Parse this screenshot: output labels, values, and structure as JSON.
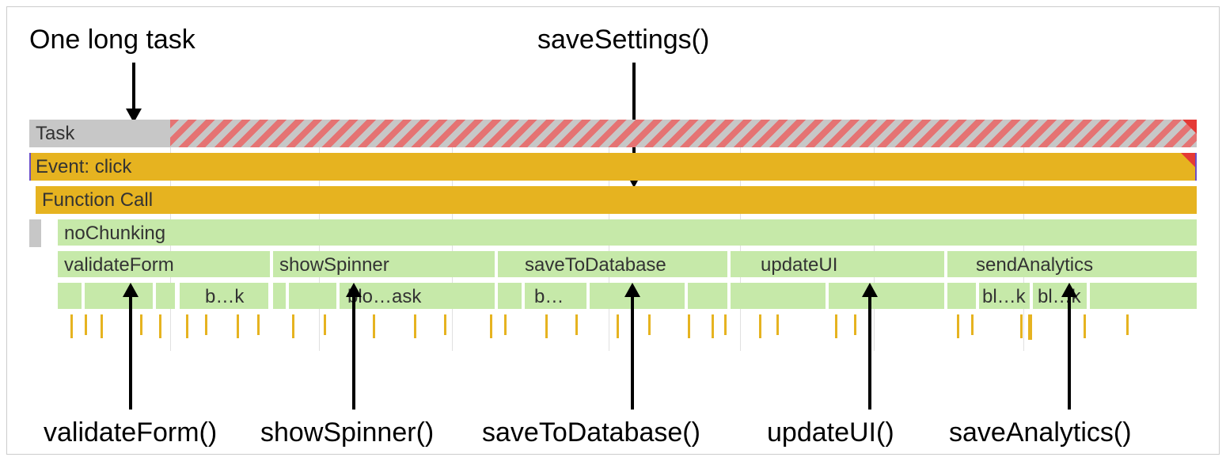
{
  "annotations": {
    "top_left": "One long task",
    "top_right": "saveSettings()",
    "bottom": [
      "validateForm()",
      "showSpinner()",
      "saveToDatabase()",
      "updateUI()",
      "saveAnalytics()"
    ]
  },
  "rows": {
    "task_label": "Task",
    "event_label": "Event: click",
    "function_call_label": "Function Call",
    "nochunking_label": "noChunking",
    "functions": [
      "validateForm",
      "showSpinner",
      "saveToDatabase",
      "updateUI",
      "sendAnalytics"
    ],
    "truncated_labels": {
      "bk1": "b…k",
      "bloask": "blo…ask",
      "b": "b…",
      "blk1": "bl…k",
      "blk2": "bl…k"
    }
  }
}
